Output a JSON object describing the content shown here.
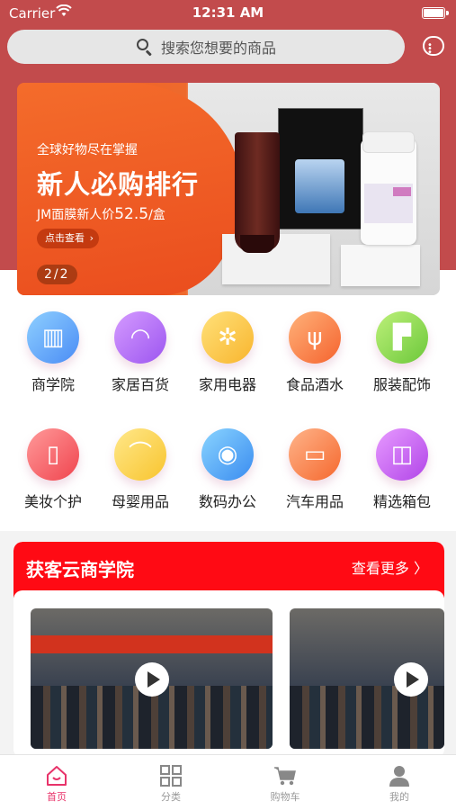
{
  "status_bar": {
    "carrier": "Carrier",
    "time": "12:31 AM"
  },
  "search": {
    "placeholder": "搜索您想要的商品"
  },
  "banner": {
    "subtitle": "全球好物尽在掌握",
    "title": "新人必购排行",
    "price_prefix": "JM面膜新人价",
    "price_value": "52.5",
    "price_unit": "/盒",
    "cta": "点击查看",
    "pager": "2/2"
  },
  "categories": [
    {
      "label": "商学院",
      "icon": "book-icon",
      "color_a": "#8fd0ff",
      "color_b": "#4a8cf5",
      "glyph": "▥"
    },
    {
      "label": "家居百货",
      "icon": "lamp-icon",
      "color_a": "#d59bff",
      "color_b": "#9c55f0",
      "glyph": "◠"
    },
    {
      "label": "家用电器",
      "icon": "fan-icon",
      "color_a": "#ffe17a",
      "color_b": "#f8b52e",
      "glyph": "✲"
    },
    {
      "label": "食品酒水",
      "icon": "utensils-icon",
      "color_a": "#ffb27a",
      "color_b": "#f5632e",
      "glyph": "ψ"
    },
    {
      "label": "服装配饰",
      "icon": "tshirt-icon",
      "color_a": "#bdf07a",
      "color_b": "#6cc83a",
      "glyph": "▛"
    },
    {
      "label": "美妆个护",
      "icon": "lipstick-icon",
      "color_a": "#ff9a9a",
      "color_b": "#f0444e",
      "glyph": "▯"
    },
    {
      "label": "母婴用品",
      "icon": "stroller-icon",
      "color_a": "#ffe88a",
      "color_b": "#f8c42e",
      "glyph": "⌒"
    },
    {
      "label": "数码办公",
      "icon": "camera-icon",
      "color_a": "#8ad4ff",
      "color_b": "#3a8cf0",
      "glyph": "◉"
    },
    {
      "label": "汽车用品",
      "icon": "car-icon",
      "color_a": "#ffb48a",
      "color_b": "#f5682e",
      "glyph": "▭"
    },
    {
      "label": "精选箱包",
      "icon": "bag-icon",
      "color_a": "#e79aff",
      "color_b": "#b145e8",
      "glyph": "◫"
    }
  ],
  "academy": {
    "title": "获客云商学院",
    "more": "查看更多"
  },
  "tabbar": [
    {
      "label": "首页",
      "icon": "home-icon",
      "active": true
    },
    {
      "label": "分类",
      "icon": "grid-icon",
      "active": false
    },
    {
      "label": "购物车",
      "icon": "cart-icon",
      "active": false
    },
    {
      "label": "我的",
      "icon": "user-icon",
      "active": false
    }
  ],
  "colors": {
    "header": "#c24b4c",
    "accent": "#ff0a14",
    "active_tab": "#e8336a"
  }
}
